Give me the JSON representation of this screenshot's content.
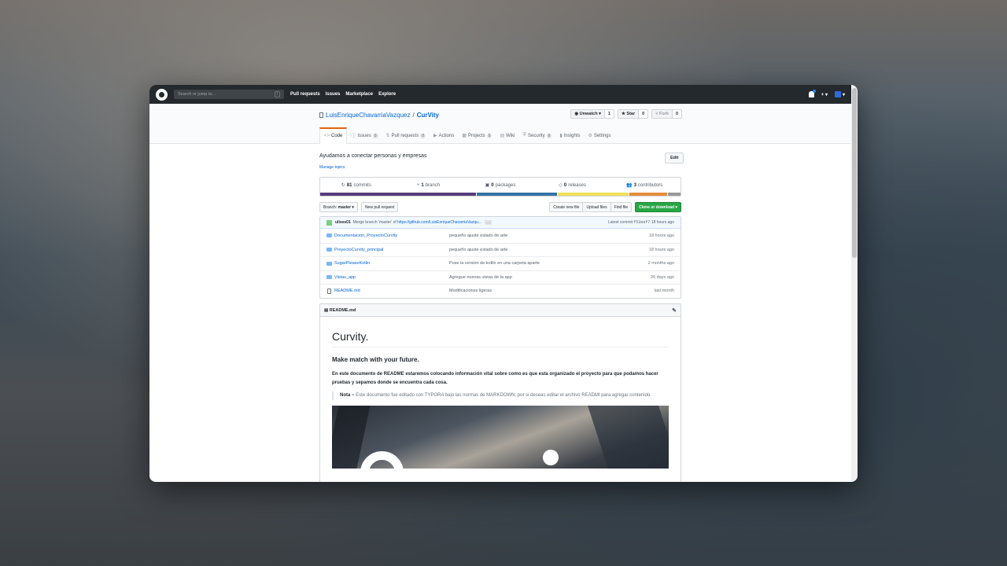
{
  "header": {
    "search_placeholder": "Search or jump to...",
    "search_shortcut": "/",
    "nav": [
      "Pull requests",
      "Issues",
      "Marketplace",
      "Explore"
    ],
    "plus": "+ ▾",
    "avatar_caret": "▾"
  },
  "repo": {
    "owner": "LuisEnriqueChavarriaVazquez",
    "separator": "/",
    "name": "CurVity",
    "actions": [
      {
        "label": "Unwatch ▾",
        "icon": "eye-icon",
        "count": "1"
      },
      {
        "label": "Star",
        "icon": "star-icon",
        "count": "0"
      },
      {
        "label": "Fork",
        "icon": "fork-icon",
        "count": "0"
      }
    ],
    "tabs": [
      {
        "label": "Code",
        "icon": "<>",
        "counter": ""
      },
      {
        "label": "Issues",
        "icon": "ⓘ",
        "counter": "0"
      },
      {
        "label": "Pull requests",
        "icon": "⇅",
        "counter": "0"
      },
      {
        "label": "Actions",
        "icon": "▶",
        "counter": ""
      },
      {
        "label": "Projects",
        "icon": "▦",
        "counter": "0"
      },
      {
        "label": "Wiki",
        "icon": "▤",
        "counter": ""
      },
      {
        "label": "Security",
        "icon": "⛨",
        "counter": "0"
      },
      {
        "label": "Insights",
        "icon": "▮",
        "counter": ""
      },
      {
        "label": "Settings",
        "icon": "⚙",
        "counter": ""
      }
    ]
  },
  "about": {
    "description": "Ayudamos a conectar personas y empresas",
    "manage_topics": "Manage topics",
    "edit": "Edit"
  },
  "stats": [
    {
      "icon": "↻",
      "count": "81",
      "label": "commits"
    },
    {
      "icon": "⑂",
      "count": "1",
      "label": "branch"
    },
    {
      "icon": "▣",
      "count": "0",
      "label": "packages"
    },
    {
      "icon": "◇",
      "count": "0",
      "label": "releases"
    },
    {
      "icon": "👥",
      "count": "3",
      "label": "contributors"
    }
  ],
  "language_bar": [
    {
      "color": "#563d7c",
      "share": 0.435
    },
    {
      "color": "#3572a5",
      "share": 0.225
    },
    {
      "color": "#f1e05a",
      "share": 0.2
    },
    {
      "color": "#e38c3a",
      "share": 0.105
    },
    {
      "color": "#999999",
      "share": 0.035
    }
  ],
  "toolbar": {
    "branch_label": "Branch:",
    "branch_value": "master ▾",
    "new_pr": "New pull request",
    "create_file": "Create new file",
    "upload": "Upload files",
    "find": "Find file",
    "clone": "Clone or download ▾"
  },
  "commit": {
    "author": "ulises01",
    "message": "Merge branch 'master' of",
    "link": "https://github.com/LuisEnriqueChavarriaVazqu...",
    "ellipsis": "…",
    "latest_label": "Latest commit",
    "sha": "f53eef7",
    "age": "18 hours ago"
  },
  "files": [
    {
      "type": "dir",
      "name": "Documentacion_ProyectoCurvity",
      "message": "pequeño ajuste estado de arte",
      "age": "18 hours ago"
    },
    {
      "type": "dir",
      "name": "ProyectoCurvity_principal",
      "message": "pequeño ajuste estado de arte",
      "age": "18 hours ago"
    },
    {
      "type": "dir",
      "name": "SugarPleaseKotlin",
      "message": "Puse la version de kotlin en una carpeta aparte",
      "age": "2 months ago"
    },
    {
      "type": "dir",
      "name": "Vistas_app",
      "message": "Agregue nuevas vistas de la app",
      "age": "26 days ago"
    },
    {
      "type": "file",
      "name": "README.md",
      "message": "Modificaciones ligeras",
      "age": "last month"
    }
  ],
  "readme": {
    "filename": "README.md",
    "h1": "Curvity.",
    "h3": "Make match with your future.",
    "lead": "En este documento de README estaremos colocando información vital sobre como es que esta organizado el proyecto para que podamos hacer pruebas y sepamos donde se encuentra cada cosa.",
    "note_label": "Nota",
    "note_text": " = Este documento fue editado con TYPORA bajo las normas de MARKDOWN; por si deseas editar el archivo READMI para agregar contenido."
  }
}
